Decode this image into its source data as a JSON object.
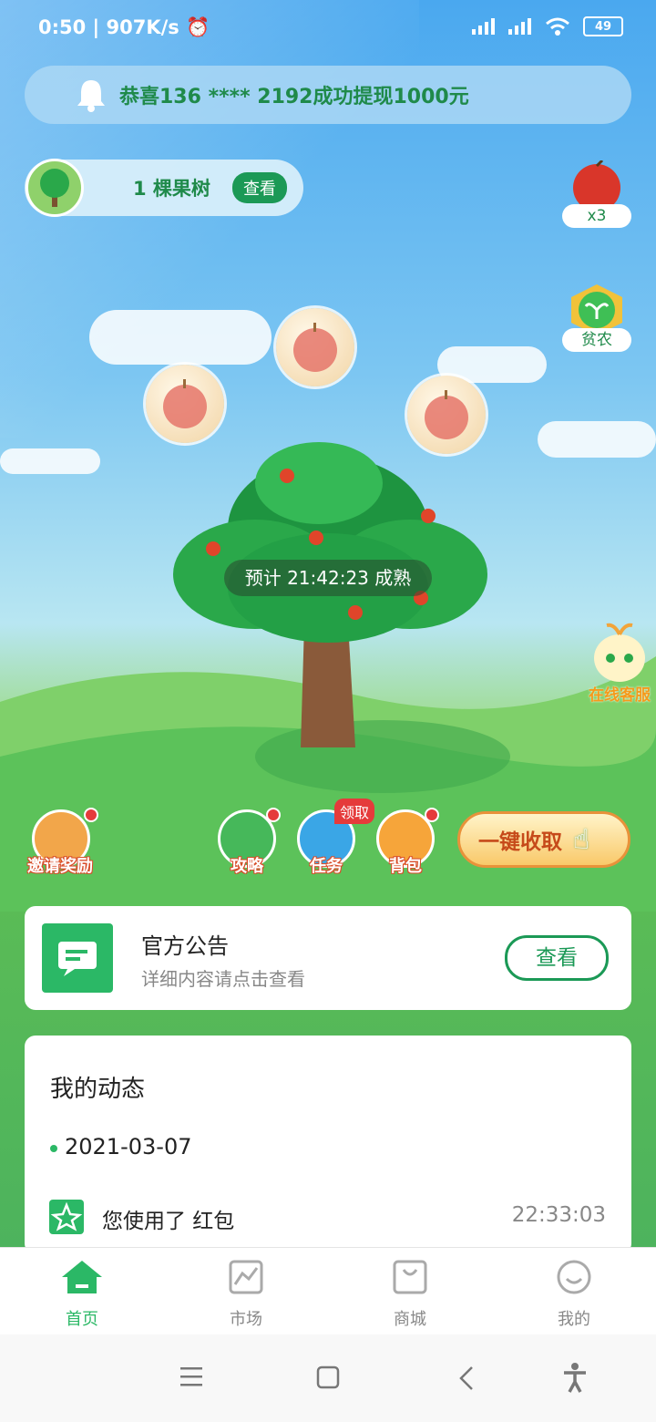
{
  "status_bar": {
    "time": "0:50",
    "speed": "907K/s",
    "battery": "49"
  },
  "notice": {
    "text": "恭喜136 **** 2192成功提现1000元"
  },
  "tree_pill": {
    "count_text": "1 棵果树",
    "view_button": "查看"
  },
  "right_badges": {
    "apple_count": "x3",
    "farmer_label": "贫农"
  },
  "countdown": {
    "text": "预计 21:42:23 成熟"
  },
  "service": {
    "label": "在线客服"
  },
  "actions": {
    "invite": "邀请奖励",
    "guide": "攻略",
    "task": "任务",
    "task_tag": "领取",
    "bag": "背包",
    "harvest": "一键收取"
  },
  "announcement": {
    "title": "官方公告",
    "subtitle": "详细内容请点击查看",
    "button": "查看"
  },
  "activity": {
    "title": "我的动态",
    "date": "2021-03-07",
    "items": [
      {
        "text": "您使用了 红包",
        "time": "22:33:03"
      }
    ]
  },
  "tabs": [
    {
      "label": "首页",
      "icon": "home-icon",
      "active": true
    },
    {
      "label": "市场",
      "icon": "market-chart-icon",
      "active": false
    },
    {
      "label": "商城",
      "icon": "shopping-bag-icon",
      "active": false
    },
    {
      "label": "我的",
      "icon": "profile-smile-icon",
      "active": false
    }
  ],
  "colors": {
    "accent": "#2bb866",
    "dark_green": "#1b9956",
    "alert": "#e53b3b"
  }
}
